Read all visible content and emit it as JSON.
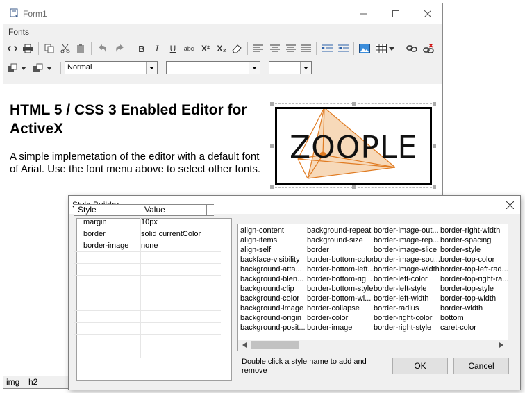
{
  "main_window": {
    "title": "Form1",
    "menu": [
      "Fonts"
    ],
    "toolbar_icons": [
      "code-view-icon",
      "print-icon",
      "copy-icon",
      "cut-icon",
      "paste-icon",
      "undo-icon",
      "redo-icon",
      "bold-icon",
      "italic-icon",
      "underline-icon",
      "strikethrough-icon",
      "superscript-icon",
      "subscript-icon",
      "eraser-icon",
      "align-left-icon",
      "align-center-icon",
      "align-justify-icon",
      "align-full-icon",
      "indent-icon",
      "outdent-icon",
      "image-icon",
      "table-icon",
      "link-icon",
      "unlink-icon"
    ],
    "toolbar_text": {
      "bold": "B",
      "italic": "I",
      "underline": "U",
      "strike": "abc",
      "sup": "X²",
      "sub": "X₂"
    },
    "format_combo": {
      "value": "Normal"
    },
    "font_combo": {
      "value": ""
    },
    "size_combo": {
      "value": ""
    },
    "document": {
      "heading": "HTML 5 / CSS 3 Enabled Editor for ActiveX",
      "paragraph": "A simple implemetation of the editor with a default font of Arial. Use the font menu above to select other fonts.",
      "logo_text": "ZOOPLE",
      "logo_colors": {
        "stroke": "#e07b22",
        "fill": "#f6d2ad",
        "dot": "#e07b22"
      }
    },
    "status": {
      "tag1": "img",
      "tag2": "h2"
    }
  },
  "style_builder": {
    "title": "Style Builder",
    "columns": {
      "style": "Style",
      "value": "Value"
    },
    "properties": [
      {
        "name": "margin",
        "value": "10px"
      },
      {
        "name": "border",
        "value": "solid currentColor"
      },
      {
        "name": "border-image",
        "value": "none"
      }
    ],
    "style_names": [
      [
        "align-content",
        "align-items",
        "align-self",
        "backface-visibility",
        "background-atta...",
        "background-blen...",
        "background-clip",
        "background-color",
        "background-image",
        "background-origin",
        "background-posit..."
      ],
      [
        "background-repeat",
        "background-size",
        "border",
        "border-bottom-color",
        "border-bottom-left...",
        "border-bottom-rig...",
        "border-bottom-style",
        "border-bottom-wi...",
        "border-collapse",
        "border-color",
        "border-image"
      ],
      [
        "border-image-out...",
        "border-image-rep...",
        "border-image-slice",
        "border-image-sou...",
        "border-image-width",
        "border-left-color",
        "border-left-style",
        "border-left-width",
        "border-radius",
        "border-right-color",
        "border-right-style"
      ],
      [
        "border-right-width",
        "border-spacing",
        "border-style",
        "border-top-color",
        "border-top-left-rad...",
        "border-top-right-ra...",
        "border-top-style",
        "border-top-width",
        "border-width",
        "bottom",
        "caret-color"
      ]
    ],
    "hint": "Double click a style name to add and remove",
    "ok_label": "OK",
    "cancel_label": "Cancel"
  }
}
